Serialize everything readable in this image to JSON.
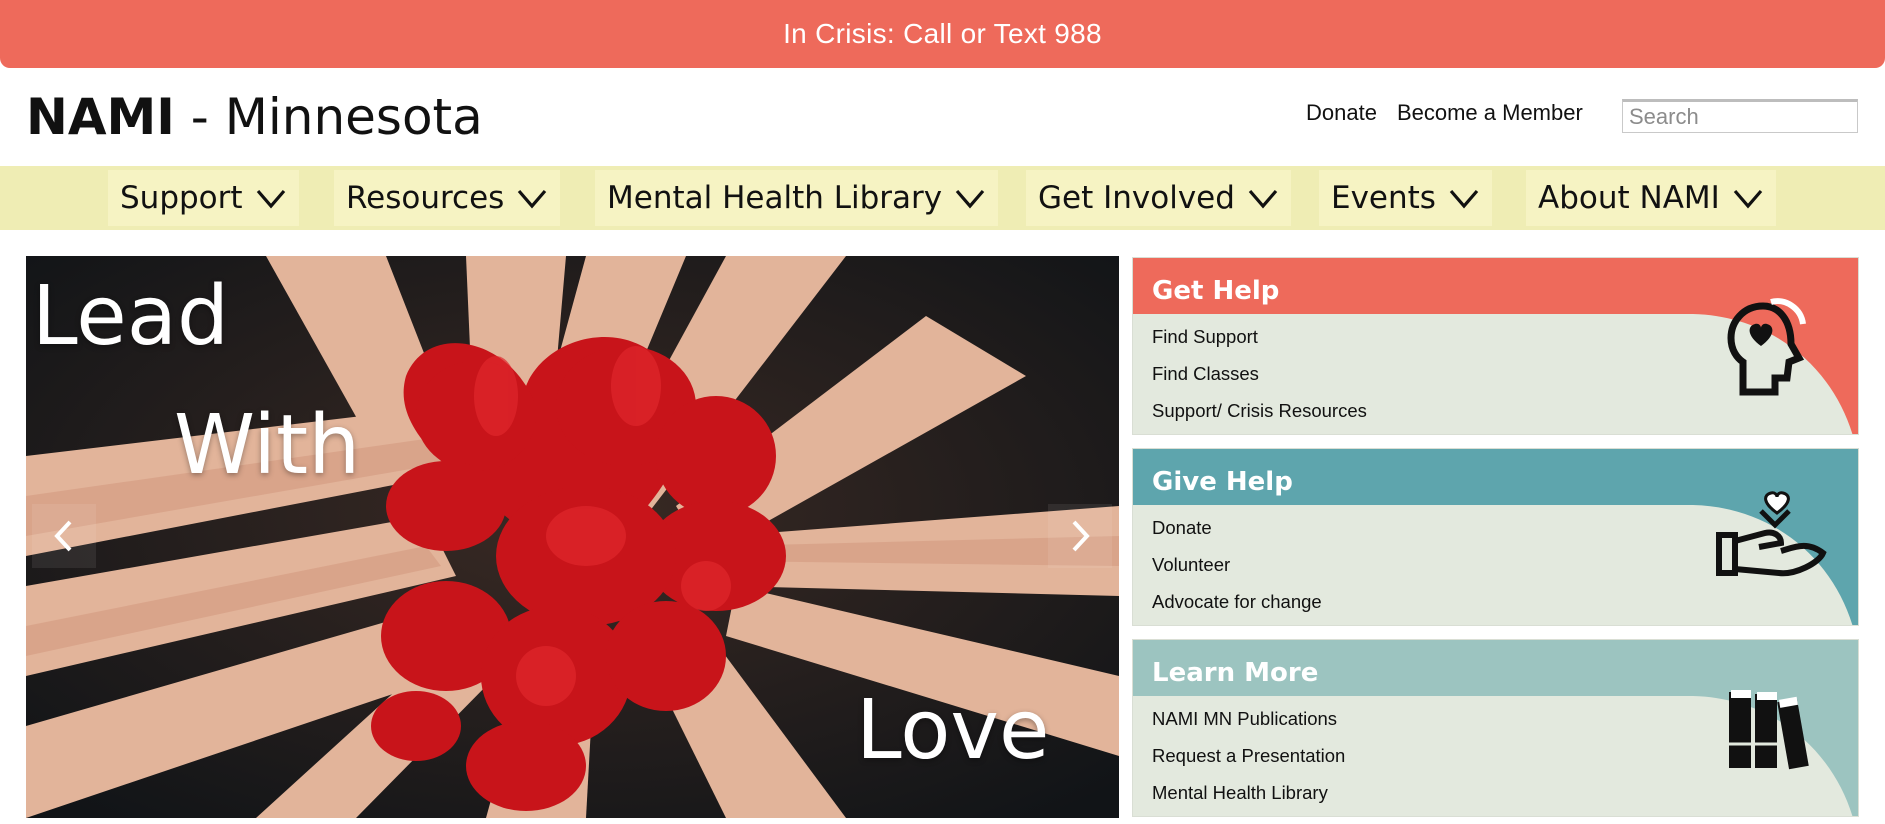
{
  "crisis_bar": {
    "text": "In Crisis: Call or Text 988"
  },
  "logo": {
    "bold": "NAMI",
    "rest": " - Minnesota"
  },
  "top_links": {
    "donate": "Donate",
    "member": "Become a Member"
  },
  "search": {
    "placeholder": "Search",
    "value": ""
  },
  "nav": {
    "items": [
      {
        "label": "Support"
      },
      {
        "label": "Resources"
      },
      {
        "label": "Mental Health Library"
      },
      {
        "label": "Get Involved"
      },
      {
        "label": "Events"
      },
      {
        "label": "About NAMI"
      }
    ]
  },
  "hero": {
    "words": [
      "Lead",
      "With",
      "Love"
    ],
    "prev_icon": "chevron-left-icon",
    "next_icon": "chevron-right-icon"
  },
  "cards": [
    {
      "title": "Get Help",
      "color": "#ee6a5b",
      "icon": "head-heart-icon",
      "links": [
        "Find Support",
        "Find Classes",
        "Support/ Crisis Resources"
      ]
    },
    {
      "title": "Give Help",
      "color": "#5ea5ad",
      "icon": "hand-heart-icon",
      "links": [
        "Donate",
        "Volunteer",
        "Advocate for change"
      ]
    },
    {
      "title": "Learn More",
      "color": "#9cc4c0",
      "icon": "books-icon",
      "links": [
        "NAMI MN Publications",
        "Request a Presentation",
        "Mental Health Library"
      ]
    }
  ],
  "colors": {
    "crisis": "#ee6a5b",
    "nav_bg": "#efedb4",
    "nav_item_bg": "#f6f3c3",
    "card_body": "#e3e9de"
  }
}
